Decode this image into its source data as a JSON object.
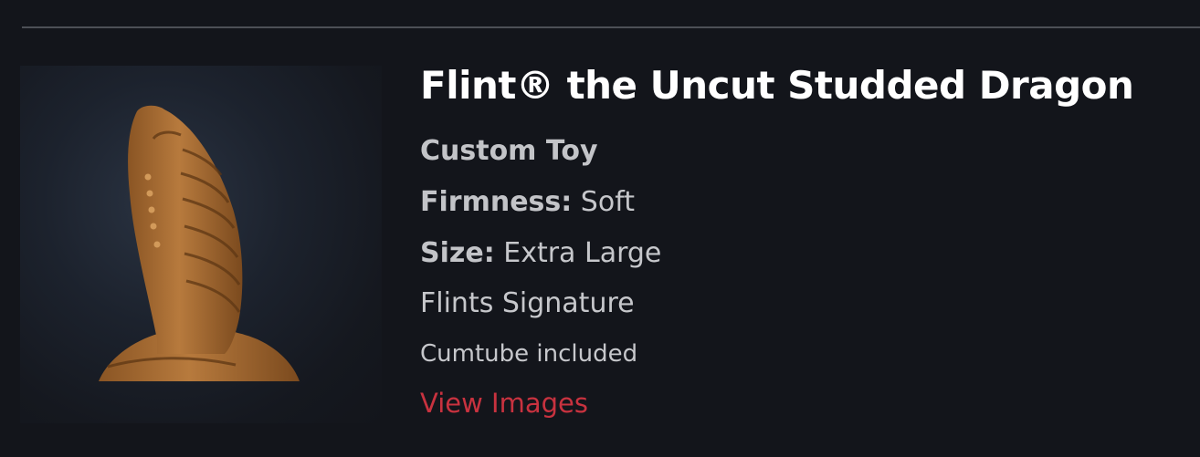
{
  "product": {
    "title": "Flint® the Uncut Studded Dragon",
    "subtitle": "Custom Toy",
    "firmness_label": "Firmness:",
    "firmness_value": "Soft",
    "size_label": "Size:",
    "size_value": "Extra Large",
    "signature": "Flints Signature",
    "cumtube": "Cumtube included",
    "view_images_link": "View Images",
    "image_icon": "product-photo"
  },
  "colors": {
    "background": "#13151b",
    "title": "#ffffff",
    "text": "#c6c7cb",
    "link": "#c8323f",
    "divider": "#4c4f56"
  }
}
